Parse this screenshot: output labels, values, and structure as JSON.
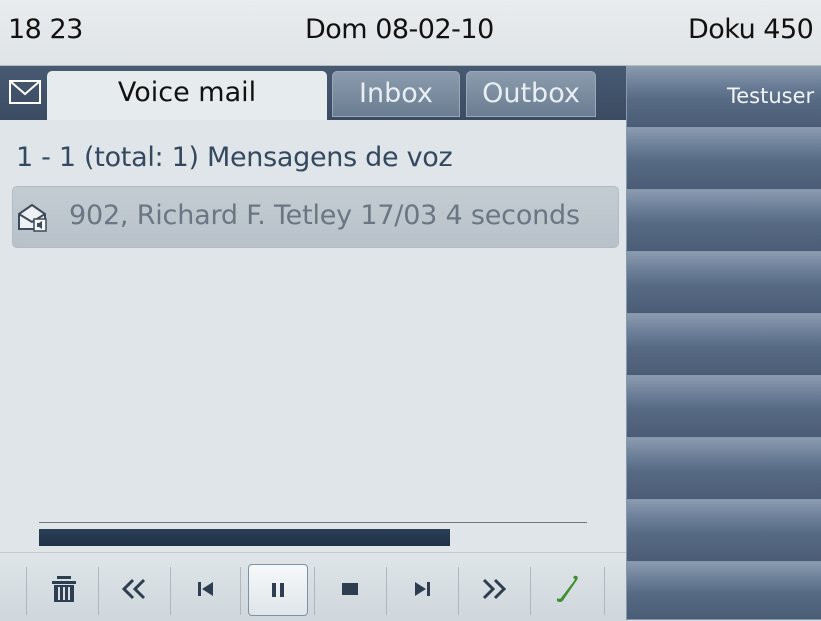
{
  "status": {
    "time": "18 23",
    "date": "Dom 08-02-10",
    "user": "Doku 450"
  },
  "tabs": [
    {
      "label": "Voice mail",
      "active": true
    },
    {
      "label": "Inbox",
      "active": false
    },
    {
      "label": "Outbox",
      "active": false
    }
  ],
  "summary": "1 - 1 (total: 1) Mensagens de voz",
  "messages": [
    {
      "text": "902, Richard F. Tetley 17/03  4 seconds",
      "icon": "voice-mail-envelope-icon"
    }
  ],
  "progress": {
    "fraction": 0.75
  },
  "controls": [
    {
      "name": "delete-icon"
    },
    {
      "name": "rewind-icon"
    },
    {
      "name": "skip-back-icon"
    },
    {
      "name": "pause-icon",
      "selected": true
    },
    {
      "name": "stop-icon"
    },
    {
      "name": "skip-forward-icon"
    },
    {
      "name": "fast-forward-icon"
    },
    {
      "name": "call-back-icon"
    }
  ],
  "right_panel": {
    "first_label": "Testuser",
    "cells": 9
  },
  "colors": {
    "accent_dark": "#2b3e57",
    "tab_bar": "#485a72",
    "call_green": "#3f8f2f"
  }
}
